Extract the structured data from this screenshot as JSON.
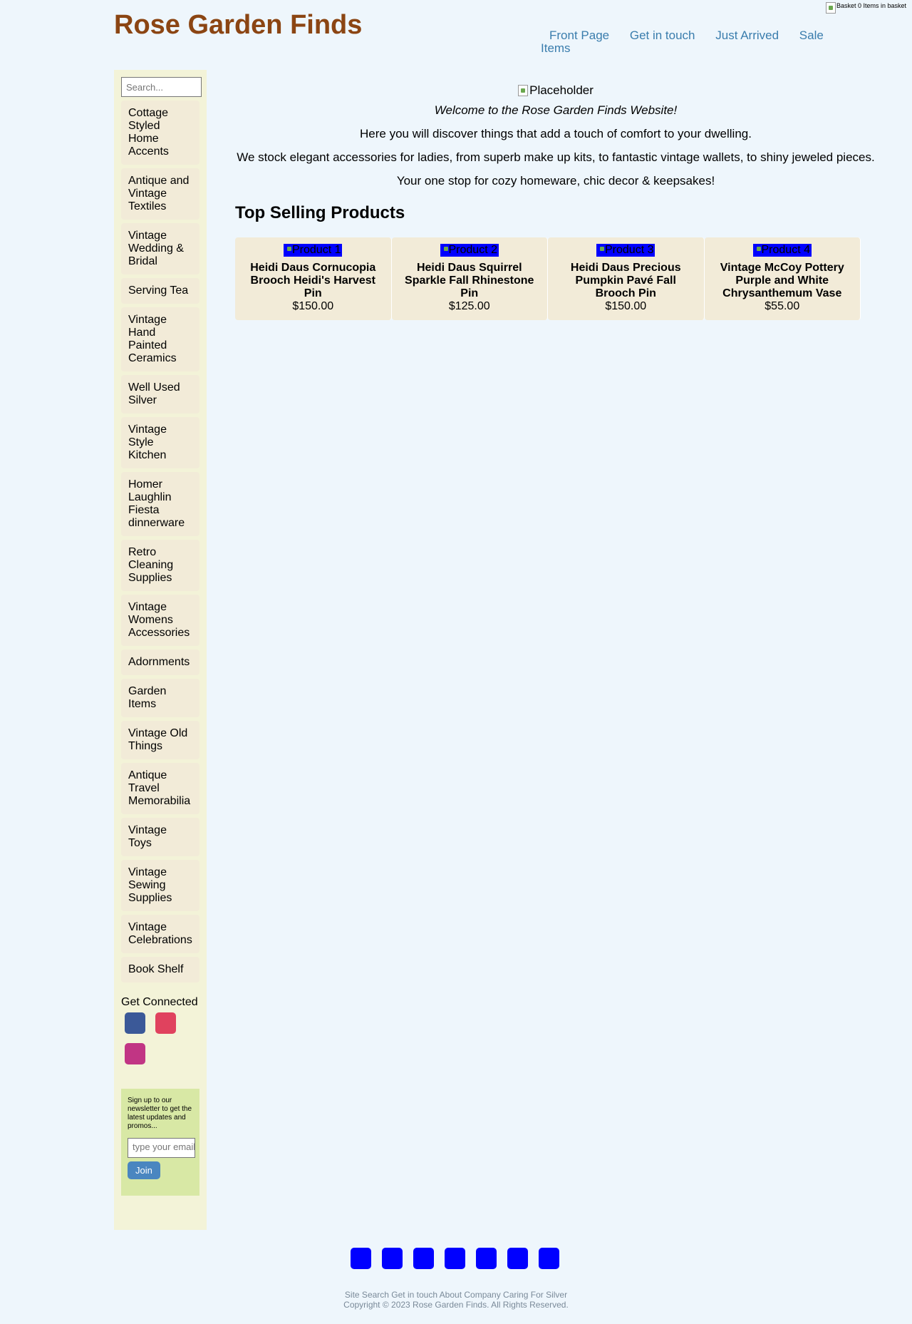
{
  "basket": {
    "text": "Basket 0 Items in basket"
  },
  "header": {
    "title": "Rose Garden Finds"
  },
  "nav": [
    "Front Page",
    "Get in touch",
    "Just Arrived",
    "Sale Items"
  ],
  "sidebar": {
    "search_placeholder": "Search...",
    "categories": [
      "Cottage Styled Home Accents",
      "Antique and Vintage Textiles",
      "Vintage Wedding & Bridal",
      "Serving Tea",
      "Vintage Hand Painted Ceramics",
      "Well Used Silver",
      "Vintage Style Kitchen",
      "Homer Laughlin Fiesta dinnerware",
      "Retro Cleaning Supplies",
      "Vintage Womens Accessories",
      "Adornments",
      "Garden Items",
      "Vintage Old Things",
      "Antique Travel Memorabilia",
      "Vintage Toys",
      "Vintage Sewing Supplies",
      "Vintage Celebrations",
      "Book Shelf"
    ],
    "connected_label": "Get Connected",
    "socials": [
      {
        "name": "facebook-icon",
        "color": "#3b5998"
      },
      {
        "name": "pinterest-icon",
        "color": "#e0425e"
      },
      {
        "name": "instagram-icon",
        "color": "#c13584"
      }
    ],
    "newsletter": {
      "text": "Sign up to our newsletter to get the latest updates and promos...",
      "email_placeholder": "type your email",
      "join_label": "Join"
    }
  },
  "main": {
    "hero_alt": "Placeholder",
    "welcome_lines": [
      "Welcome to the Rose Garden Finds Website!",
      "Here you will discover things that add a touch of comfort to your dwelling.",
      "We stock elegant accessories for ladies, from superb make up kits, to fantastic vintage wallets, to shiny jeweled pieces.",
      "Your one stop for cozy homeware, chic decor & keepsakes!"
    ],
    "section_title": "Top Selling Products",
    "products": [
      {
        "alt": "Product 1",
        "name": "Heidi Daus Cornucopia Brooch Heidi's Harvest Pin",
        "price": "$150.00"
      },
      {
        "alt": "Product 2",
        "name": "Heidi Daus Squirrel Sparkle Fall Rhinestone Pin",
        "price": "$125.00"
      },
      {
        "alt": "Product 3",
        "name": "Heidi Daus Precious Pumpkin Pavé Fall Brooch Pin",
        "price": "$150.00"
      },
      {
        "alt": "Product 4",
        "name": "Vintage McCoy Pottery Purple and White Chrysanthemum Vase",
        "price": "$55.00"
      }
    ]
  },
  "footer": {
    "links": "Site Search Get in touch About Company Caring For Silver",
    "copyright": "Copyright © 2023 Rose Garden Finds. All Rights Reserved.",
    "icon_count": 7,
    "icon_color": "#0000ff"
  }
}
